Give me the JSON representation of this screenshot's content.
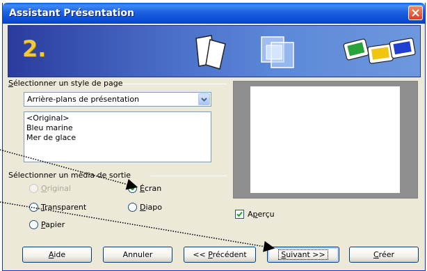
{
  "window": {
    "title": "Assistant Présentation",
    "close_icon": "close-icon"
  },
  "banner": {
    "step": "2."
  },
  "page_style": {
    "group_label_mnemonic": "S",
    "group_label_rest": "électionner un style de page",
    "selected": "Arrière-plans de présentation",
    "items": [
      "<Original>",
      "Bleu marine",
      "Mer de glace"
    ]
  },
  "output_medium": {
    "group_label": "Sélectionner un média de sortie",
    "options": [
      {
        "mnemonic": "O",
        "rest": "riginal",
        "disabled": true,
        "checked": false
      },
      {
        "mnemonic": "É",
        "rest": "cran",
        "disabled": false,
        "checked": true
      },
      {
        "mnemonic": "T",
        "rest": "ransparent",
        "disabled": false,
        "checked": false
      },
      {
        "mnemonic": "D",
        "rest": "iapo",
        "disabled": false,
        "checked": false
      },
      {
        "mnemonic": "P",
        "rest": "apier",
        "disabled": false,
        "checked": false
      }
    ]
  },
  "preview": {
    "checkbox_pre": "A",
    "checkbox_mnemonic": "p",
    "checkbox_rest": "erçu",
    "checked": true
  },
  "buttons": {
    "help_mnemonic": "A",
    "help_rest": "ide",
    "cancel": "Annuler",
    "back_pre": "<< ",
    "back_mnemonic": "P",
    "back_rest": "récédent",
    "next_mnemonic": "S",
    "next_rest": "uivant >>",
    "create_mnemonic": "C",
    "create_rest": "réer"
  },
  "colors": {
    "titlebar": "#0a4bd4",
    "banner": "#4a6fc9",
    "step_number": "#f2c93a",
    "radio_dot": "#21a121",
    "check_mark": "#21a121"
  }
}
